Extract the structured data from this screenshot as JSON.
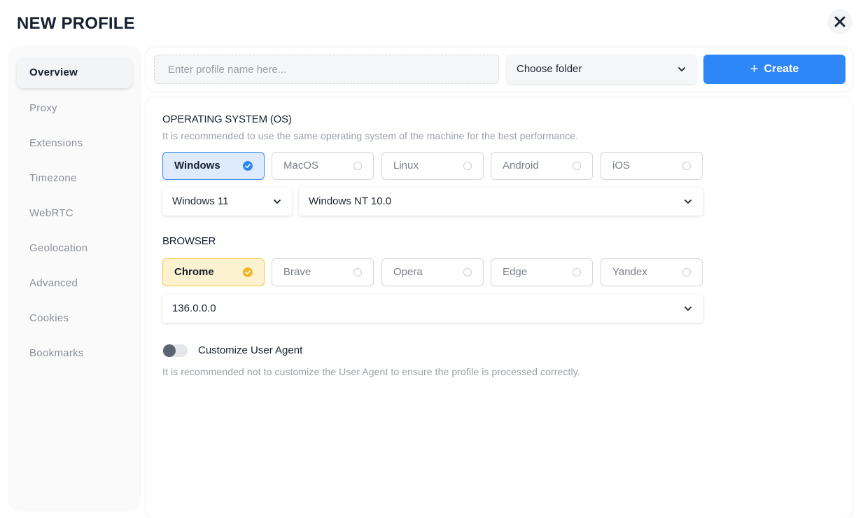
{
  "title": "NEW PROFILE",
  "close_icon": "close-icon",
  "sidebar": {
    "items": [
      {
        "label": "Overview",
        "active": true
      },
      {
        "label": "Proxy"
      },
      {
        "label": "Extensions"
      },
      {
        "label": "Timezone"
      },
      {
        "label": "WebRTC"
      },
      {
        "label": "Geolocation"
      },
      {
        "label": "Advanced"
      },
      {
        "label": "Cookies"
      },
      {
        "label": "Bookmarks"
      }
    ]
  },
  "topbar": {
    "name_placeholder": "Enter profile name here...",
    "name_value": "",
    "folder_label": "Choose folder",
    "create_label": "Create"
  },
  "os": {
    "title": "OPERATING SYSTEM (OS)",
    "hint": "It is recommended to use the same operating system of the machine for the best performance.",
    "options": [
      "Windows",
      "MacOS",
      "Linux",
      "Android",
      "iOS"
    ],
    "selected": "Windows",
    "version": "Windows 11",
    "platform": "Windows NT 10.0"
  },
  "browser": {
    "title": "BROWSER",
    "options": [
      "Chrome",
      "Brave",
      "Opera",
      "Edge",
      "Yandex"
    ],
    "selected": "Chrome",
    "version": "136.0.0.0"
  },
  "user_agent": {
    "label": "Customize User Agent",
    "enabled": false,
    "hint": "It is recommended not to customize the User Agent to ensure the profile is processed correctly."
  },
  "colors": {
    "accent": "#2f86f6",
    "os_selected_bg": "#deebfd",
    "browser_selected_bg": "#fdf2cf",
    "browser_check": "#f2b526"
  }
}
